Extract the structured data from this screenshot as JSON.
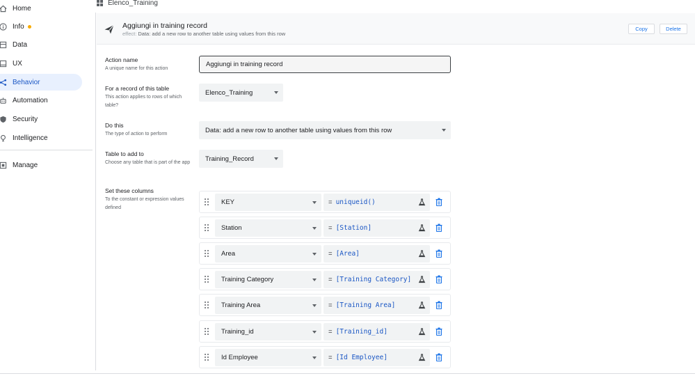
{
  "sidebar": {
    "items": [
      {
        "label": "Home",
        "icon": "home-icon"
      },
      {
        "label": "Info",
        "icon": "info-icon",
        "badge_color": "#f9ab00"
      },
      {
        "label": "Data",
        "icon": "data-icon"
      },
      {
        "label": "UX",
        "icon": "ux-icon"
      },
      {
        "label": "Behavior",
        "icon": "behavior-icon",
        "active": true
      },
      {
        "label": "Automation",
        "icon": "automation-icon"
      },
      {
        "label": "Security",
        "icon": "security-icon"
      },
      {
        "label": "Intelligence",
        "icon": "intelligence-icon"
      },
      {
        "label": "Manage",
        "icon": "manage-icon"
      }
    ]
  },
  "breadcrumb": {
    "table": "Elenco_Training"
  },
  "action": {
    "title": "Aggiungi in training record",
    "effect_key": "effect:",
    "effect_value": "Data: add a new row to another table using values from this row",
    "copy_label": "Copy",
    "delete_label": "Delete"
  },
  "form": {
    "action_name": {
      "title": "Action name",
      "desc": "A unique name for this action",
      "value": "Aggiungi in training record"
    },
    "record_table": {
      "title": "For a record of this table",
      "desc": "This action applies to rows of which table?",
      "value": "Elenco_Training"
    },
    "do_this": {
      "title": "Do this",
      "desc": "The type of action to perform",
      "value": "Data: add a new row to another table using values from this row"
    },
    "table_to_add": {
      "title": "Table to add to",
      "desc": "Choose any table that is part of the app",
      "value": "Training_Record"
    },
    "set_columns": {
      "title": "Set these columns",
      "desc": "To the constant or expression values defined"
    }
  },
  "columns": [
    {
      "column": "KEY",
      "expression": "uniqueid()"
    },
    {
      "column": "Station",
      "expression": "[Station]"
    },
    {
      "column": "Area",
      "expression": "[Area]"
    },
    {
      "column": "Training Category",
      "expression": "[Training Category]"
    },
    {
      "column": "Training Area",
      "expression": "[Training Area]"
    },
    {
      "column": "Training_id",
      "expression": "[Training_id]"
    },
    {
      "column": "Id Employee",
      "expression": "[Id Employee]"
    }
  ],
  "equals_sign": "=",
  "colors": {
    "accent": "#1a73e8",
    "active_bg": "#e8f0fe",
    "active_text": "#1a56c4",
    "field_bg": "#f1f3f4"
  }
}
